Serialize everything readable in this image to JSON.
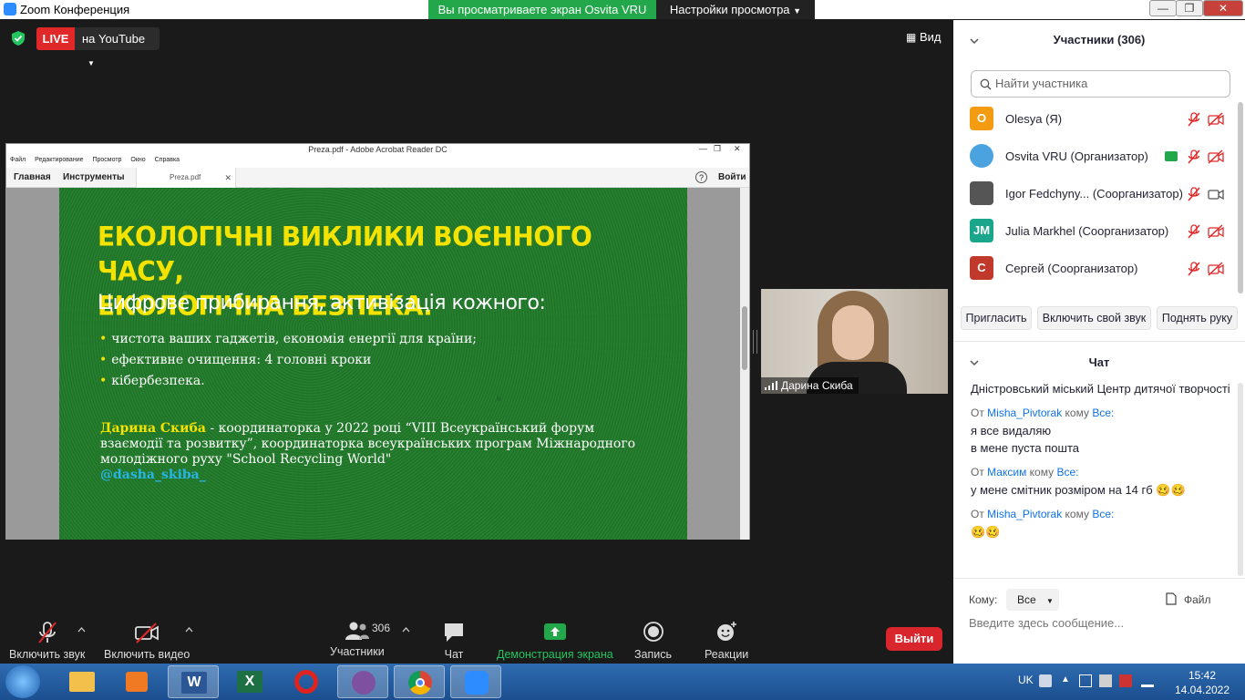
{
  "window": {
    "title": "Zoom Конференция",
    "viewing_banner": "Вы просматриваете экран Osvita VRU",
    "view_settings": "Настройки просмотра"
  },
  "topbar": {
    "live_label": "LIVE",
    "live_target": "на YouTube",
    "view_label": "Вид"
  },
  "shared_screen": {
    "pdf_title": "Preza.pdf - Adobe Acrobat Reader DC",
    "menu": [
      "Файл",
      "Редактирование",
      "Просмотр",
      "Окно",
      "Справка"
    ],
    "tab_home": "Главная",
    "tab_tools": "Инструменты",
    "doc_tab": "Preza.pdf",
    "sign_in": "Войти",
    "slide": {
      "title_line1": "ЕКОЛОГІЧНІ ВИКЛИКИ ВОЄННОГО ЧАСУ,",
      "title_line2": "ЕКОЛОГІЧНА БЕЗПЕКА.",
      "subtitle": "Цифрове прибирання, активізація кожного:",
      "bullets": [
        "чистота ваших гаджетів, економія енергії для країни;",
        "ефективне очищення: 4 головні кроки",
        "кібербезпека."
      ],
      "credit_name": "Дарина Скиба",
      "credit_text": " - координаторка  у 2022 році “VIII Всеукраїнський форум взаємодії та розвитку”, координаторка всеукраїнських програм Міжнародного молодіжного руху \"School Recycling World\"",
      "credit_handle": "@dasha_skiba_"
    }
  },
  "speaker": {
    "name": "Дарина Скиба"
  },
  "participants": {
    "header": "Участники (306)",
    "search_placeholder": "Найти участника",
    "list": [
      {
        "initials": "O",
        "name": "Olesya (Я)",
        "color": "#f39c12"
      },
      {
        "initials": "",
        "name": "Osvita VRU (Организатор)",
        "color": "#4aa3df"
      },
      {
        "initials": "",
        "name": "Igor Fedchyny... (Соорганизатор)",
        "color": "#555555"
      },
      {
        "initials": "JM",
        "name": "Julia Markhel  (Соорганизатор)",
        "color": "#1aa68a"
      },
      {
        "initials": "С",
        "name": "Сергей (Соорганизатор)",
        "color": "#c0392b"
      }
    ],
    "invite": "Пригласить",
    "unmute_self": "Включить свой звук",
    "raise_hand": "Поднять руку"
  },
  "chat": {
    "header": "Чат",
    "messages": [
      {
        "text": "Дністровський міський Центр дитячої творчості"
      },
      {
        "from_prefix": "От ",
        "from": "Misha_Pivtorak",
        "to_prefix": " кому ",
        "to": "Все:",
        "lines": [
          "я все видаляю",
          "в мене пуста пошта"
        ]
      },
      {
        "from_prefix": "От ",
        "from": "Максим",
        "to_prefix": "  кому ",
        "to": "Все:",
        "lines": [
          "у мене смітник розміром на 14 гб 🥴🥴"
        ]
      },
      {
        "from_prefix": "От ",
        "from": "Misha_Pivtorak",
        "to_prefix": " кому ",
        "to": "Все:",
        "lines": [
          "🥴🥴"
        ]
      }
    ],
    "to_label": "Кому:",
    "to_value": "Все",
    "file_label": "Файл",
    "input_placeholder": "Введите здесь сообщение..."
  },
  "toolbar": {
    "unmute": "Включить звук",
    "start_video": "Включить видео",
    "participants": "Участники",
    "participants_count": "306",
    "chat": "Чат",
    "share": "Демонстрация экрана",
    "record": "Запись",
    "reactions": "Реакции",
    "leave": "Выйти"
  },
  "taskbar": {
    "lang": "UK",
    "time": "15:42",
    "date": "14.04.2022"
  },
  "colors": {
    "zoom_blue": "#0e72ed",
    "share_green": "#22a84a",
    "live_red": "#e02828",
    "leave_red": "#d8262c",
    "slide_yellow": "#f4e300",
    "slide_green": "#24762c"
  }
}
